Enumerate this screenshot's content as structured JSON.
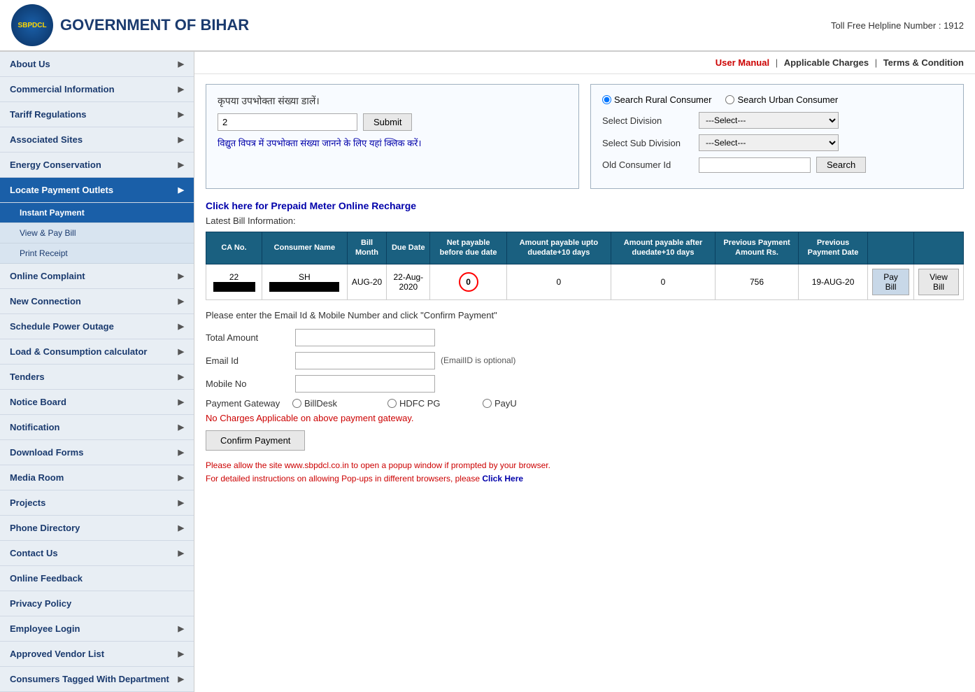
{
  "header": {
    "logo_text": "SBPDCL",
    "title": "GOVERNMENT OF BIHAR",
    "helpline": "Toll Free Helpline Number : 1912"
  },
  "top_links": {
    "user_manual": "User Manual",
    "separator1": "|",
    "applicable_charges": "Applicable Charges",
    "separator2": "|",
    "terms_condition": "Terms & Condition"
  },
  "sidebar": {
    "items": [
      {
        "label": "About Us",
        "has_arrow": true
      },
      {
        "label": "Commercial Information",
        "has_arrow": true
      },
      {
        "label": "Tariff Regulations",
        "has_arrow": true
      },
      {
        "label": "Associated Sites",
        "has_arrow": true
      },
      {
        "label": "Energy Conservation",
        "has_arrow": true
      },
      {
        "label": "Locate Payment Outlets",
        "has_arrow": true,
        "active": true
      },
      {
        "label": "Instant Payment",
        "sub": true,
        "active_sub": true
      },
      {
        "label": "View & Pay Bill",
        "sub_child": true
      },
      {
        "label": "Print Receipt",
        "sub_child": true
      },
      {
        "label": "Online Complaint",
        "has_arrow": true
      },
      {
        "label": "New Connection",
        "has_arrow": true
      },
      {
        "label": "Schedule Power Outage",
        "has_arrow": true
      },
      {
        "label": "Load & Consumption calculator",
        "has_arrow": true
      },
      {
        "label": "Tenders",
        "has_arrow": true
      },
      {
        "label": "Notice Board",
        "has_arrow": true
      },
      {
        "label": "Notification",
        "has_arrow": true
      },
      {
        "label": "Download Forms",
        "has_arrow": true
      },
      {
        "label": "Media Room",
        "has_arrow": true
      },
      {
        "label": "Projects",
        "has_arrow": true
      },
      {
        "label": "Phone Directory",
        "has_arrow": true
      },
      {
        "label": "Contact Us",
        "has_arrow": true
      },
      {
        "label": "Online Feedback",
        "has_arrow": false
      },
      {
        "label": "Privacy Policy",
        "has_arrow": false
      },
      {
        "label": "Employee Login",
        "has_arrow": true
      },
      {
        "label": "Approved Vendor List",
        "has_arrow": true
      },
      {
        "label": "Consumers Tagged With Department",
        "has_arrow": true
      }
    ]
  },
  "consumer_section": {
    "label": "कृपया उपभोक्ता संख्या डालें।",
    "input_placeholder": "2",
    "submit_label": "Submit",
    "link_text": "विद्युत विपत्र में उपभोक्ता संख्या जानने के लिए यहां क्लिक करें।"
  },
  "search_section": {
    "rural_label": "Search Rural Consumer",
    "urban_label": "Search Urban Consumer",
    "division_label": "Select Division",
    "division_placeholder": "---Select---",
    "subdivision_label": "Select Sub Division",
    "subdivision_placeholder": "---Select---",
    "old_consumer_label": "Old Consumer Id",
    "search_btn": "Search"
  },
  "prepaid_link": "Click here for Prepaid Meter Online Recharge",
  "bill_info_label": "Latest Bill Information:",
  "bill_table": {
    "headers": [
      "CA No.",
      "Consumer Name",
      "Bill Month",
      "Due Date",
      "Net payable before due date",
      "Amount payable upto duedate+10 days",
      "Amount payable after duedate+10 days",
      "Previous Payment Amount Rs.",
      "Previous Payment Date"
    ],
    "row": {
      "ca_no": "22",
      "consumer_name": "SH",
      "bill_month": "AUG-20",
      "due_date": "22-Aug-2020",
      "net_payable": "0",
      "amount_upto_10": "0",
      "amount_after_10": "0",
      "prev_payment_amount": "756",
      "prev_payment_date": "19-AUG-20",
      "pay_bill_btn": "Pay Bill",
      "view_bill_btn": "View Bill"
    }
  },
  "payment_form": {
    "instruction": "Please enter the Email Id & Mobile Number and click \"Confirm Payment\"",
    "total_amount_label": "Total Amount",
    "email_label": "Email Id",
    "email_optional": "(EmailID is optional)",
    "mobile_label": "Mobile No",
    "gateway_label": "Payment Gateway",
    "gateways": [
      "BillDesk",
      "HDFC PG",
      "PayU"
    ],
    "no_charges": "No Charges Applicable on above payment gateway.",
    "confirm_btn": "Confirm Payment",
    "popup_note1": "Please allow the site www.sbpdcl.co.in to open a popup window if prompted by your browser.",
    "popup_note2": "For detailed instructions on allowing Pop-ups in different browsers, please",
    "click_here": "Click Here"
  }
}
